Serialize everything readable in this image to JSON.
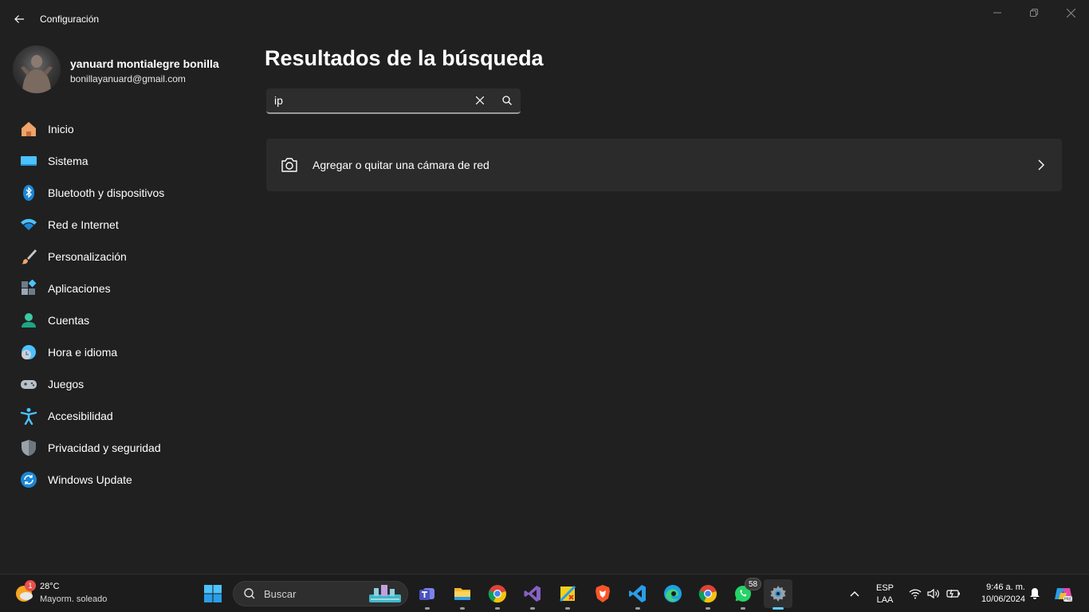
{
  "window": {
    "app_title": "Configuración",
    "back_icon": "arrow-left-icon",
    "controls": [
      "minimize-icon",
      "restore-icon",
      "close-icon"
    ]
  },
  "user": {
    "name": "yanuard montialegre bonilla",
    "email": "bonillayanuard@gmail.com"
  },
  "sidebar": {
    "items": [
      {
        "label": "Inicio",
        "icon": "home-icon"
      },
      {
        "label": "Sistema",
        "icon": "system-icon"
      },
      {
        "label": "Bluetooth y dispositivos",
        "icon": "bluetooth-icon"
      },
      {
        "label": "Red e Internet",
        "icon": "wifi-icon"
      },
      {
        "label": "Personalización",
        "icon": "brush-icon"
      },
      {
        "label": "Aplicaciones",
        "icon": "apps-icon"
      },
      {
        "label": "Cuentas",
        "icon": "account-icon"
      },
      {
        "label": "Hora e idioma",
        "icon": "time-language-icon"
      },
      {
        "label": "Juegos",
        "icon": "gamepad-icon"
      },
      {
        "label": "Accesibilidad",
        "icon": "accessibility-icon"
      },
      {
        "label": "Privacidad y seguridad",
        "icon": "shield-icon"
      },
      {
        "label": "Windows Update",
        "icon": "update-icon"
      }
    ]
  },
  "main": {
    "title": "Resultados de la búsqueda",
    "search": {
      "value": "ip"
    },
    "results": [
      {
        "label": "Agregar o quitar una cámara de red",
        "icon": "camera-icon"
      }
    ]
  },
  "taskbar": {
    "weather": {
      "temp": "28°C",
      "desc": "Mayorm. soleado",
      "badge": "1"
    },
    "search_label": "Buscar",
    "apps": [
      "start",
      "teams",
      "file-explorer",
      "chrome",
      "visual-studio",
      "photo-editor",
      "brave",
      "vscode",
      "edge",
      "chrome",
      "whatsapp",
      "settings"
    ],
    "whatsapp_badge": "58",
    "language": {
      "line1": "ESP",
      "line2": "LAA"
    },
    "clock": {
      "time": "9:46 a. m.",
      "date": "10/06/2024"
    }
  },
  "colors": {
    "background": "#202020",
    "card": "#2b2b2b",
    "accent": "#60cdff"
  }
}
